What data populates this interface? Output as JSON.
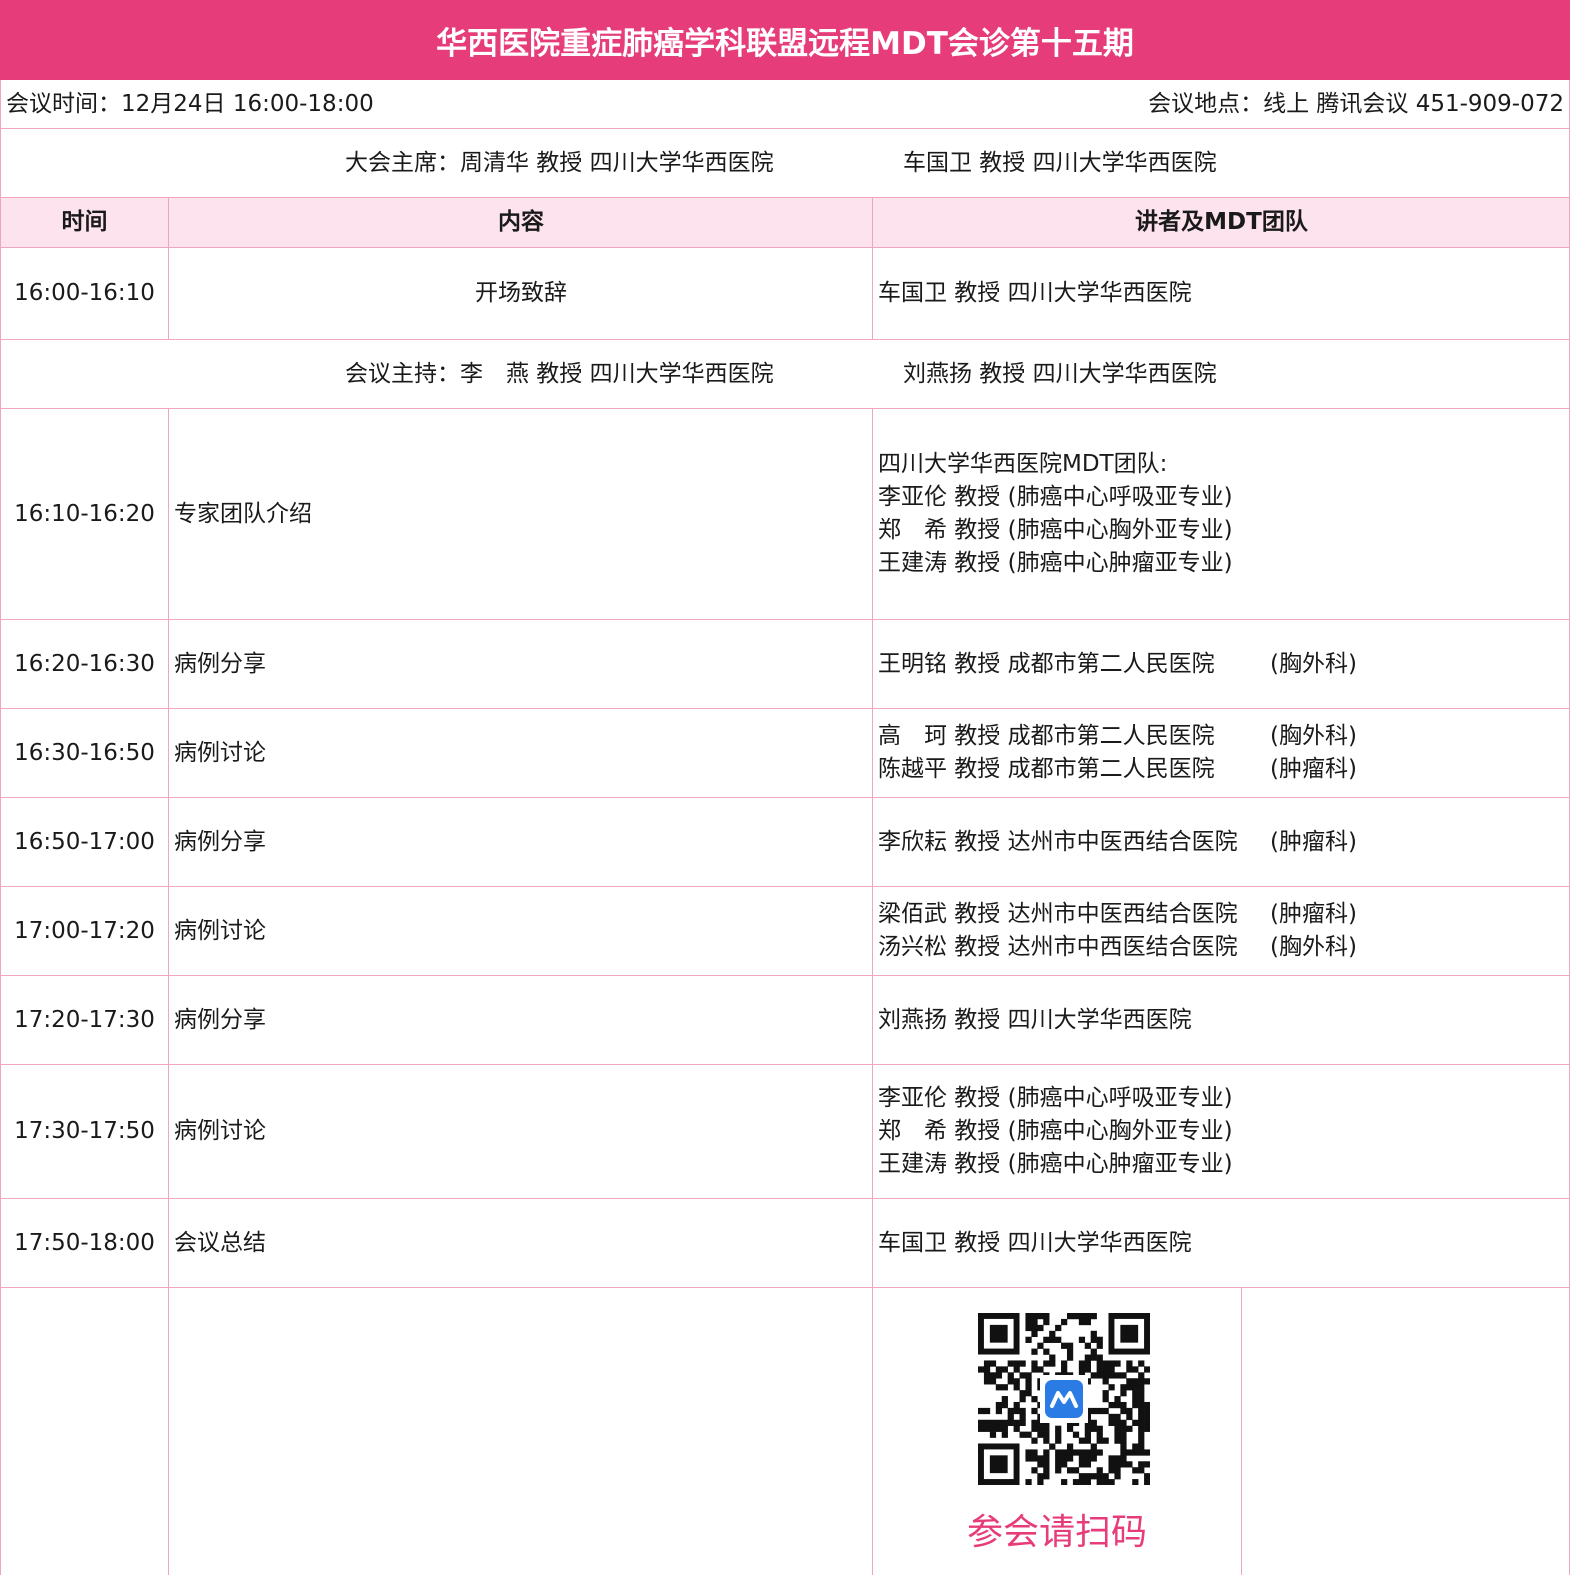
{
  "title": "华西医院重症肺癌学科联盟远程MDT会诊第十五期",
  "meeting_time": "会议时间：12月24日 16:00-18:00",
  "meeting_location": "会议地点：线上 腾讯会议 451-909-072",
  "chairs": {
    "left": "大会主席：周清华 教授 四川大学华西医院",
    "right": "车国卫 教授 四川大学华西医院"
  },
  "headers": {
    "time": "时间",
    "content": "内容",
    "speaker": "讲者及MDT团队"
  },
  "rows": [
    {
      "time": "16:00-16:10",
      "content": "开场致辞",
      "speaker": "车国卫 教授 四川大学华西医院"
    },
    {
      "time": "16:10-16:20",
      "content": "专家团队介绍",
      "speakers": [
        "四川大学华西医院MDT团队:",
        "李亚伦 教授 (肺癌中心呼吸亚专业)",
        "郑　希 教授 (肺癌中心胸外亚专业)",
        "王建涛 教授 (肺癌中心肿瘤亚专业)"
      ]
    },
    {
      "time": "16:20-16:30",
      "content": "病例分享",
      "speaker": "王明铭 教授 成都市第二人民医院",
      "dept": "(胸外科)"
    },
    {
      "time": "16:30-16:50",
      "content": "病例讨论",
      "speakers2": [
        {
          "name": "高　珂 教授 成都市第二人民医院",
          "dept": "(胸外科)"
        },
        {
          "name": "陈越平 教授 成都市第二人民医院",
          "dept": "(肿瘤科)"
        }
      ]
    },
    {
      "time": "16:50-17:00",
      "content": "病例分享",
      "speaker": "李欣耘 教授 达州市中医西结合医院",
      "dept": "(肿瘤科)"
    },
    {
      "time": "17:00-17:20",
      "content": "病例讨论",
      "speakers2": [
        {
          "name": "梁佰武 教授 达州市中医西结合医院",
          "dept": "(肿瘤科)"
        },
        {
          "name": "汤兴松 教授 达州市中西医结合医院",
          "dept": "(胸外科)"
        }
      ]
    },
    {
      "time": "17:20-17:30",
      "content": "病例分享",
      "speaker": "刘燕扬 教授 四川大学华西医院"
    },
    {
      "time": "17:30-17:50",
      "content": "病例讨论",
      "speakers": [
        "李亚伦 教授 (肺癌中心呼吸亚专业)",
        "郑　希 教授 (肺癌中心胸外亚专业)",
        "王建涛 教授 (肺癌中心肿瘤亚专业)"
      ]
    },
    {
      "time": "17:50-18:00",
      "content": "会议总结",
      "speaker": "车国卫 教授 四川大学华西医院"
    }
  ],
  "hosts": {
    "left": "会议主持：李　燕 教授 四川大学华西医院",
    "right": "刘燕扬 教授 四川大学华西医院"
  },
  "qr_caption": "参会请扫码",
  "colors": {
    "accent": "#e63c7a",
    "header_bg": "#fde3ee",
    "grid": "#f0a6c1",
    "qr_center": "#2b7be4"
  }
}
